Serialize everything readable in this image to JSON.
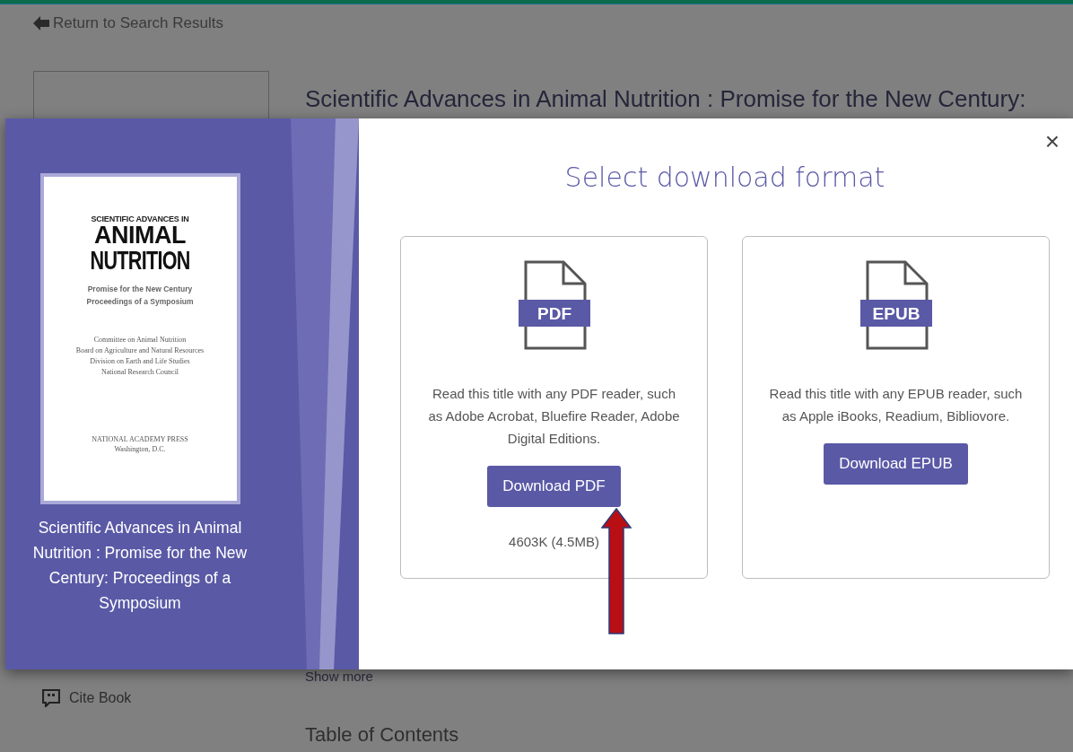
{
  "page": {
    "back_link": "Return to Search Results",
    "title": "Scientific Advances in Animal Nutrition : Promise for the New Century:",
    "show_more": "Show more",
    "cite": "Cite Book",
    "toc_heading": "Table of Contents"
  },
  "modal": {
    "close": "×",
    "heading": "Select download format",
    "book": {
      "caption": "Scientific Advances in Animal Nutrition : Promise for the New Century: Proceedings of a Symposium",
      "cover": {
        "kicker": "SCIENTIFIC ADVANCES IN",
        "title_1": "ANIMAL",
        "title_2": "NUTRITION",
        "subtitle_1": "Promise for the New Century",
        "subtitle_2": "Proceedings of a Symposium",
        "authors": [
          "Committee on Animal Nutrition",
          "Board on Agriculture and Natural Resources",
          "Division on Earth and Life Studies",
          "National Research Council"
        ],
        "publisher": "NATIONAL ACADEMY PRESS",
        "place": "Washington, D.C."
      }
    },
    "formats": [
      {
        "badge": "PDF",
        "description": "Read this title with any PDF reader, such as Adobe Acrobat, Bluefire Reader, Adobe Digital Editions.",
        "button": "Download PDF",
        "size": "4603K (4.5MB)"
      },
      {
        "badge": "EPUB",
        "description": "Read this title with any EPUB reader, such as Apple iBooks, Readium, Bibliovore.",
        "button": "Download EPUB"
      }
    ]
  },
  "annotation": {
    "kind": "arrow"
  }
}
